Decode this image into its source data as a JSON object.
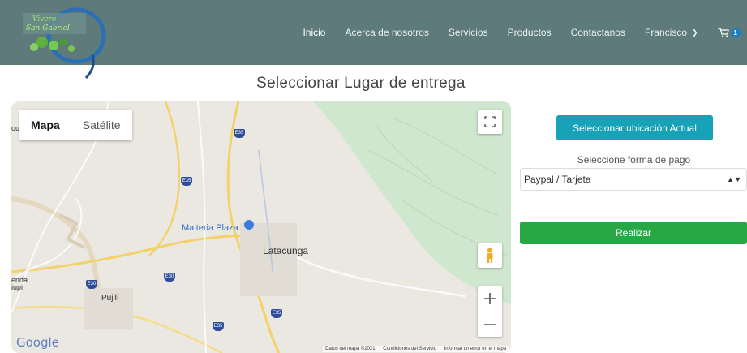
{
  "nav": {
    "links": [
      "Inicio",
      "Acerca de nosotros",
      "Servicios",
      "Productos",
      "Contactanos"
    ],
    "user": "Francisco",
    "cart_count": "1"
  },
  "page": {
    "title": "Seleccionar Lugar de entrega"
  },
  "map": {
    "type_map": "Mapa",
    "type_satellite": "Satélite",
    "labels": {
      "malteria": "Malteria Plaza",
      "latacunga": "Latacunga",
      "pujili": "Pujilí",
      "enda": "enda",
      "iupi": "iupi",
      "ou": "ou"
    },
    "shields": [
      "E35",
      "E35",
      "E30",
      "E30",
      "E35",
      "E35"
    ],
    "google": "Google",
    "attribution": {
      "data": "Datos del mapa ©2021",
      "terms": "Condiciones del Servicio",
      "report": "Informar un error en el mapa"
    }
  },
  "panel": {
    "location_button": "Seleccionar ubicación Actual",
    "payment_label": "Seleccione forma de pago",
    "payment_selected": "Paypal / Tarjeta",
    "submit_button": "Realizar"
  },
  "colors": {
    "navbar": "#5e7a7a",
    "location_button": "#17a2b8",
    "submit_button": "#28a745"
  }
}
